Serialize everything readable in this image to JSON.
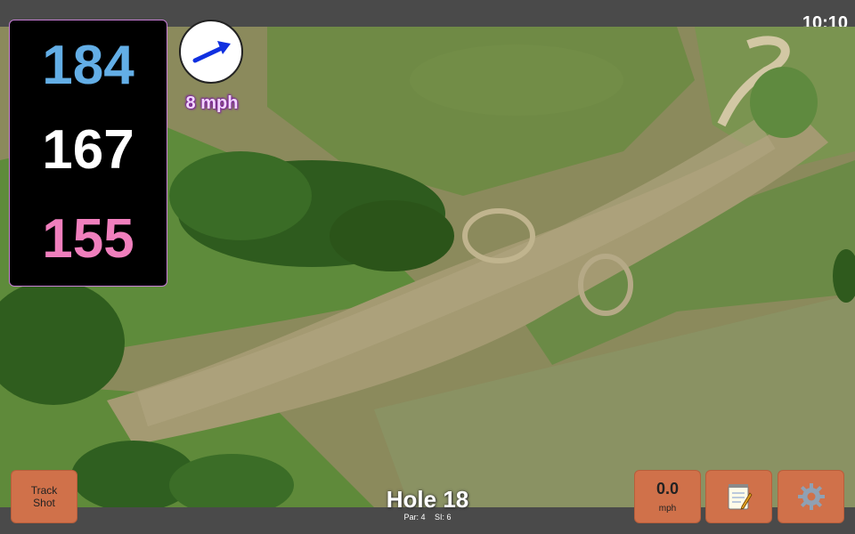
{
  "status_bar": {
    "time": "10:10"
  },
  "distances": {
    "back": "184",
    "middle": "167",
    "front": "155"
  },
  "wind": {
    "speed": "8 mph",
    "icon": "wind-direction-arrow-icon",
    "arrow_color": "#1030e0"
  },
  "hole": {
    "title": "Hole 18",
    "par": "Par: 4",
    "si": "SI: 6"
  },
  "buttons": {
    "track_shot_line1": "Track",
    "track_shot_line2": "Shot",
    "speed_value": "0.0",
    "speed_unit": "mph",
    "notes_icon": "notepad-icon",
    "settings_icon": "gear-icon"
  },
  "colors": {
    "back_distance": "#63aee6",
    "middle_distance": "#ffffff",
    "front_distance": "#f07fbd",
    "button": "#d0714a",
    "bar": "#4a4a4a"
  }
}
